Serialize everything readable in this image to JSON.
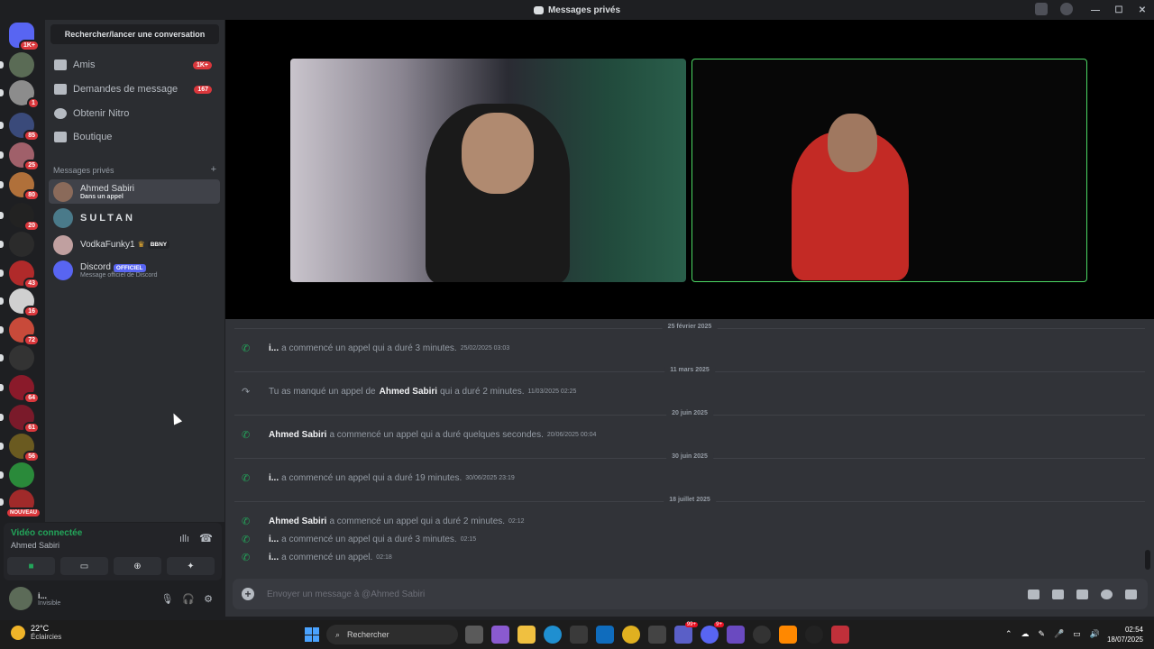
{
  "window": {
    "title": "Messages privés",
    "controls": [
      "minimize",
      "maximize",
      "close"
    ]
  },
  "servers": [
    {
      "name": "discord-home",
      "badge": "1K+",
      "color": "#5865f2"
    },
    {
      "name": "server-1",
      "badge": "",
      "color": "#5a6b55"
    },
    {
      "name": "server-2",
      "badge": "1",
      "color": "#8c8c8c"
    },
    {
      "name": "server-3",
      "badge": "85",
      "color": "#3a4a7a"
    },
    {
      "name": "server-4",
      "badge": "25",
      "color": "#a0606a"
    },
    {
      "name": "server-5",
      "badge": "80",
      "color": "#b0703a"
    },
    {
      "name": "server-6",
      "badge": "20",
      "color": "#222222"
    },
    {
      "name": "server-7",
      "badge": "",
      "color": "#2b2b2b"
    },
    {
      "name": "server-8",
      "badge": "43",
      "color": "#b02a2a"
    },
    {
      "name": "server-9",
      "badge": "16",
      "color": "#d0d0d0"
    },
    {
      "name": "server-10",
      "badge": "72",
      "color": "#c84a3a"
    },
    {
      "name": "server-11",
      "badge": "",
      "color": "#333333"
    },
    {
      "name": "server-12",
      "badge": "64",
      "color": "#8a1a2a"
    },
    {
      "name": "server-13",
      "badge": "61",
      "color": "#7a1a2a"
    },
    {
      "name": "server-14",
      "badge": "56",
      "color": "#6a5a20"
    },
    {
      "name": "server-15",
      "badge": "",
      "color": "#2a8a3a"
    },
    {
      "name": "server-16",
      "badge": "NOUVEAU",
      "color": "#a02a2a"
    }
  ],
  "dm_panel": {
    "search_label": "Rechercher/lancer une conversation",
    "nav": [
      {
        "label": "Amis",
        "count": "1K+"
      },
      {
        "label": "Demandes de message",
        "count": "167"
      },
      {
        "label": "Obtenir Nitro",
        "count": ""
      },
      {
        "label": "Boutique",
        "count": ""
      }
    ],
    "section_title": "Messages privés",
    "section_add": "+",
    "dms": [
      {
        "name": "Ahmed Sabiri",
        "sub": "Dans un appel",
        "tag": "",
        "color": "#8a6a5a"
      },
      {
        "name": "SULTAN",
        "sub": "",
        "tag": "",
        "color": "#4a7a8a"
      },
      {
        "name": "VodkaFunky1",
        "sub": "",
        "tag": "BBNY",
        "color": "#c0a0a0"
      },
      {
        "name": "Discord",
        "sub": "Message officiel de Discord",
        "tag": "OFFICIEL",
        "color": "#5865f2"
      }
    ]
  },
  "voice": {
    "status": "Vidéo connectée",
    "channel": "Ahmed Sabiri"
  },
  "user": {
    "name": "i...",
    "status": "Invisible"
  },
  "chat": {
    "dividers": [
      "25 février 2025",
      "11 mars 2025",
      "20 juin 2025",
      "30 juin 2025",
      "18 juillet 2025"
    ],
    "messages": [
      {
        "author": "i...",
        "text": "a commencé un appel qui a duré 3 minutes.",
        "time": "25/02/2025 03:03",
        "missed": false
      },
      {
        "author": "Ahmed Sabiri",
        "pre": "Tu as manqué un appel de",
        "text": "qui a duré 2 minutes.",
        "time": "11/03/2025 02:25",
        "missed": true
      },
      {
        "author": "Ahmed Sabiri",
        "text": "a commencé un appel qui a duré quelques secondes.",
        "time": "20/06/2025 00:04",
        "missed": false
      },
      {
        "author": "i...",
        "text": "a commencé un appel qui a duré 19 minutes.",
        "time": "30/06/2025 23:19",
        "missed": false
      },
      {
        "author": "Ahmed Sabiri",
        "text": "a commencé un appel qui a duré 2 minutes.",
        "time": "02:12",
        "missed": false
      },
      {
        "author": "i...",
        "text": "a commencé un appel qui a duré 3 minutes.",
        "time": "02:15",
        "missed": false
      },
      {
        "author": "i...",
        "text": "a commencé un appel.",
        "time": "02:18",
        "missed": false
      }
    ],
    "input_placeholder": "Envoyer un message à @Ahmed Sabiri"
  },
  "taskbar": {
    "weather_temp": "22°C",
    "weather_desc": "Éclaircies",
    "search": "Rechercher",
    "badges": {
      "teams": "99+",
      "discord": "9+"
    },
    "time": "02:54",
    "date": "18/07/2025"
  }
}
